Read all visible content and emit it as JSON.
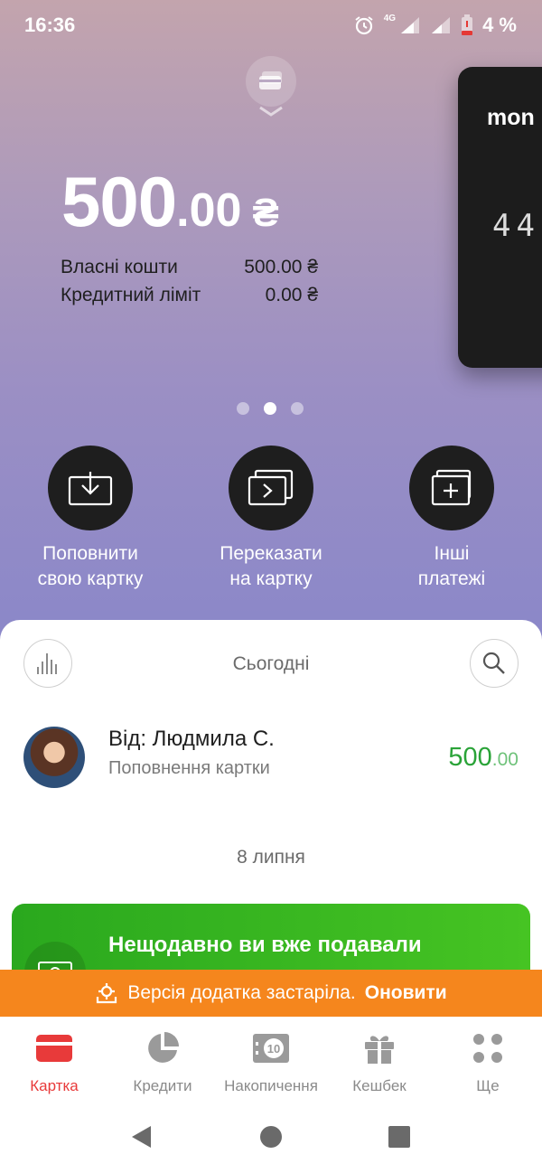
{
  "status_bar": {
    "time": "16:36",
    "battery": "4 %",
    "network": "4G"
  },
  "balance": {
    "integer": "500",
    "decimal": ".00",
    "currency": "₴"
  },
  "funds": [
    {
      "label": "Власні кошти",
      "value": "500.00 ₴"
    },
    {
      "label": "Кредитний ліміт",
      "value": "0.00 ₴"
    }
  ],
  "card": {
    "brand": "mon",
    "digits": "44"
  },
  "pager": {
    "count": 3,
    "active_index": 1
  },
  "actions": [
    {
      "line1": "Поповнити",
      "line2": "свою картку",
      "icon": "download-box-icon"
    },
    {
      "line1": "Переказати",
      "line2": "на картку",
      "icon": "card-transfer-icon"
    },
    {
      "line1": "Інші",
      "line2": "платежі",
      "icon": "card-plus-icon"
    }
  ],
  "feed": {
    "today_label": "Сьогодні",
    "transaction": {
      "title": "Від: Людмила С.",
      "subtitle": "Поповнення картки",
      "amount_int": "500",
      "amount_dec": ".00"
    },
    "date_label": "8 липня",
    "promo_title": "Нещодавно ви вже подавали"
  },
  "update_banner": {
    "text": "Версія додатка застаріла.",
    "link": "Оновити"
  },
  "bottom_nav": [
    {
      "label": "Картка",
      "icon": "card-icon",
      "active": true
    },
    {
      "label": "Кредити",
      "icon": "pie-chart-icon",
      "active": false
    },
    {
      "label": "Накопичення",
      "icon": "savings-icon",
      "badge": "10",
      "active": false
    },
    {
      "label": "Кешбек",
      "icon": "gift-icon",
      "active": false
    },
    {
      "label": "Ще",
      "icon": "more-dots-icon",
      "active": false
    }
  ],
  "colors": {
    "accent_red": "#e83a3a",
    "positive_green": "#2aa338",
    "banner_orange": "#f5861d",
    "promo_green": "#3cb522"
  }
}
